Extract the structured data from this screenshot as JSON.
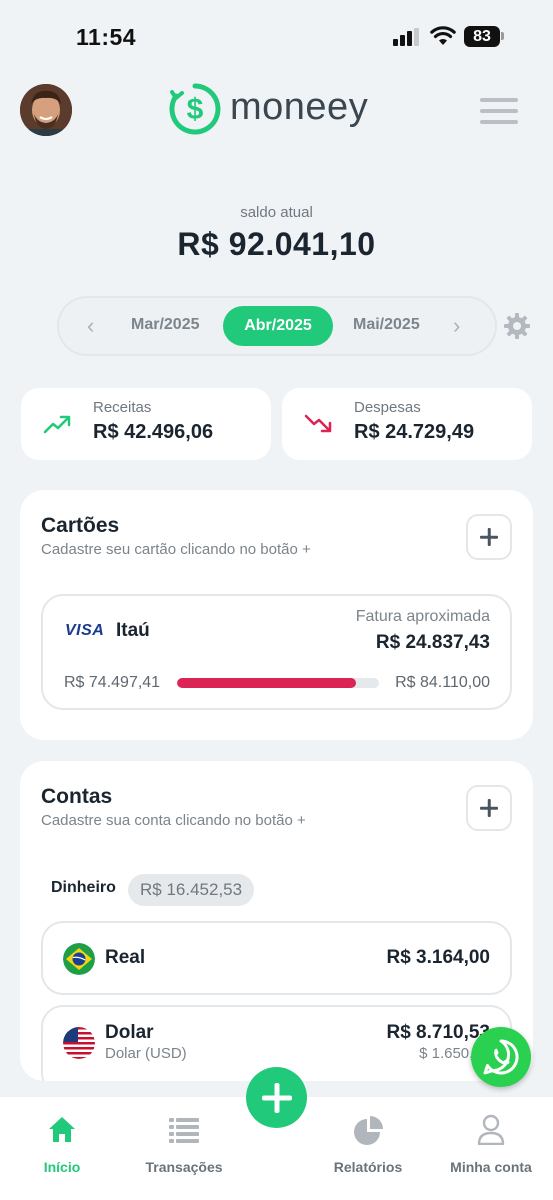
{
  "status_bar": {
    "time": "11:54",
    "battery": "83"
  },
  "header": {
    "logo_text": "moneey",
    "avatar_icon": "user-avatar",
    "menu_icon": "hamburger-menu-icon"
  },
  "balance": {
    "label": "saldo atual",
    "value": "R$ 92.041,10"
  },
  "months": {
    "prev": "Mar/2025",
    "current": "Abr/2025",
    "next": "Mai/2025"
  },
  "summary": {
    "income": {
      "label": "Receitas",
      "value": "R$ 42.496,06",
      "color": "#21c97b"
    },
    "expense": {
      "label": "Despesas",
      "value": "R$ 24.729,49",
      "color": "#dc2355"
    }
  },
  "cards": {
    "title": "Cartões",
    "subtitle": "Cadastre seu cartão clicando no botão +",
    "items": [
      {
        "brand": "VISA",
        "bank": "Itaú",
        "invoice_label": "Fatura aproximada",
        "invoice_value": "R$ 24.837,43",
        "used": "R$ 74.497,41",
        "limit": "R$ 84.110,00",
        "used_fraction": 0.886
      }
    ]
  },
  "accounts": {
    "title": "Contas",
    "subtitle": "Cadastre sua conta clicando no botão +",
    "cash_label": "Dinheiro",
    "cash_value": "R$ 16.452,53",
    "items": [
      {
        "name": "Real",
        "value": "R$ 3.164,00",
        "flag": "brazil-flag-icon"
      },
      {
        "name": "Dolar",
        "sub": "Dolar (USD)",
        "value": "R$ 8.710,53",
        "subvalue": "$ 1.650,00",
        "flag": "usa-flag-icon"
      }
    ]
  },
  "tabs": [
    {
      "label": "Início",
      "icon": "home-icon",
      "active": true
    },
    {
      "label": "Transações",
      "icon": "list-icon",
      "active": false
    },
    {
      "label": "Relatórios",
      "icon": "pie-chart-icon",
      "active": false
    },
    {
      "label": "Minha conta",
      "icon": "user-icon",
      "active": false
    }
  ],
  "colors": {
    "brand": "#21c97b",
    "expense": "#dc2355",
    "whatsapp": "#2ad04f"
  }
}
